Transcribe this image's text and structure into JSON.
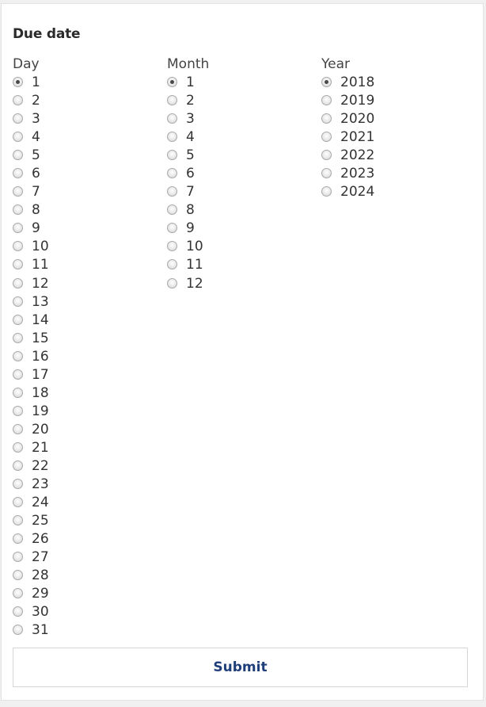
{
  "form": {
    "title": "Due date",
    "submit_label": "Submit"
  },
  "columns": {
    "day": {
      "label": "Day",
      "selected": "1",
      "options": [
        "1",
        "2",
        "3",
        "4",
        "5",
        "6",
        "7",
        "8",
        "9",
        "10",
        "11",
        "12",
        "13",
        "14",
        "15",
        "16",
        "17",
        "18",
        "19",
        "20",
        "21",
        "22",
        "23",
        "24",
        "25",
        "26",
        "27",
        "28",
        "29",
        "30",
        "31"
      ]
    },
    "month": {
      "label": "Month",
      "selected": "1",
      "options": [
        "1",
        "2",
        "3",
        "4",
        "5",
        "6",
        "7",
        "8",
        "9",
        "10",
        "11",
        "12"
      ]
    },
    "year": {
      "label": "Year",
      "selected": "2018",
      "options": [
        "2018",
        "2019",
        "2020",
        "2021",
        "2022",
        "2023",
        "2024"
      ]
    }
  },
  "colors": {
    "title": "#2b2b2b",
    "submit_text": "#1f3f7a",
    "border": "#d6d6d6"
  }
}
